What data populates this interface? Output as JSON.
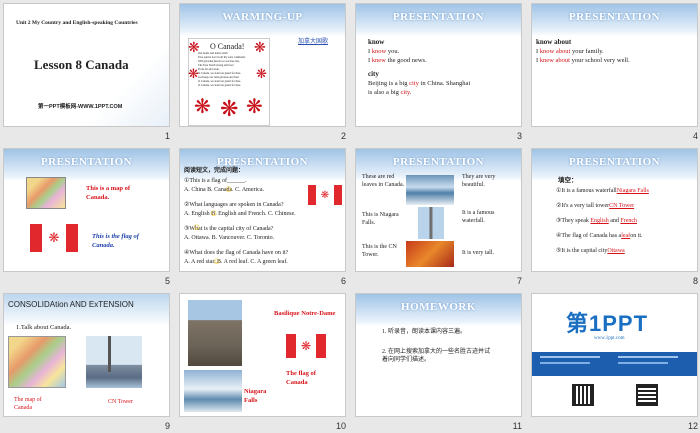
{
  "slides": [
    {
      "num": "1",
      "unit": "Unit 2 My Country and English-speaking Countries",
      "title": "Lesson 8  Canada",
      "footer": "第一PPT模板网-WWW.1PPT.COM"
    },
    {
      "num": "2",
      "title": "WARMING-UP",
      "poem_title": "O Canada!",
      "poem_lines": [
        "Our home and native land!",
        "True patriot love in all thy sons command.",
        "With glowing hearts we see thee rise,",
        "The True North strong and free!",
        "From far and wide,",
        "O Canada, we stand on guard for thee.",
        "God keep our land glorious and free!",
        "O Canada, we stand on guard for thee.",
        "O Canada, we stand on guard for thee."
      ],
      "side": "加拿大国歌"
    },
    {
      "num": "3",
      "title": "PRESENTATION",
      "w1": "know",
      "l1a": "I ",
      "l1b": "know",
      "l1c": " you.",
      "l2a": "I ",
      "l2b": "knew",
      "l2c": " the good news.",
      "w2": "city",
      "l3a": "Beijing is a big ",
      "l3b": "city",
      "l3c": " in China. Shanghai",
      "l4a": "is also a big ",
      "l4b": "city",
      "l4c": "."
    },
    {
      "num": "4",
      "title": "PRESENTATION",
      "w1": "know about",
      "l1a": "I ",
      "l1b": "know about",
      "l1c": " your family.",
      "l2a": "I ",
      "l2b": "knew about",
      "l2c": " your school very well."
    },
    {
      "num": "5",
      "title": "PRESENTATION",
      "c1": "This is a map of Canada.",
      "c2": "This is the flag of Canada."
    },
    {
      "num": "6",
      "title": "PRESENTATION",
      "head": "阅读短文，完成问题：",
      "q1": "①This is a flag of______.",
      "q1o": "A. China   B. Canada.      C. America.",
      "q2": "②What languages are spoken in Canada?",
      "q2o": "A. English   B. English and French.  C. Chinese.",
      "q3": "③What is the capital city of Canada?",
      "q3o": "A. Ottawa.    B. Vancouver.        C. Toronto.",
      "q4": "④What does the flag of Canada have on it?",
      "q4o": "A. A red star.   B. A red leaf.      C. A green leaf."
    },
    {
      "num": "7",
      "title": "PRESENTATION",
      "a": "These are red leaves in Canada.",
      "b": "They are very beautiful.",
      "c": "This is Niagara Falls.",
      "d": "It is a famous waterfall.",
      "e": "This is the CN Tower.",
      "f": "It is very tall."
    },
    {
      "num": "8",
      "title": "PRESENTATION",
      "head": "填空：",
      "l1a": "①It is a famous waterfall",
      "l1b": "Niagara Falls",
      "l2a": "②It's a very tall tower",
      "l2b": "CN Tower",
      "l3a": "③They speak ",
      "l3b": "English",
      "l3c": " and ",
      "l3d": "French",
      "l4a": "④The flag of Canada has a",
      "l4b": "leaf",
      "l4c": "on it.",
      "l5a": "⑤It is the capital city",
      "l5b": "Ottawa"
    },
    {
      "num": "9",
      "title": "CONSOLIDAtion AND ExTENSION",
      "sub": "1.Talk about Canada.",
      "c1": "The map of Canada",
      "c2": "CN Tower"
    },
    {
      "num": "10",
      "c1": "Basilique Notre-Dame",
      "c2": "The flag of Canada",
      "c3": "Niagara Falls"
    },
    {
      "num": "11",
      "title": "HOMEWORK",
      "l1": "1. 听录音，朗读本课内容三遍。",
      "l2": "2. 在网上搜索加拿大的一些名胜古迹并试着向同学们描述。"
    },
    {
      "num": "12",
      "logo": "第1PPT",
      "sub": "www.1ppt.com"
    }
  ]
}
